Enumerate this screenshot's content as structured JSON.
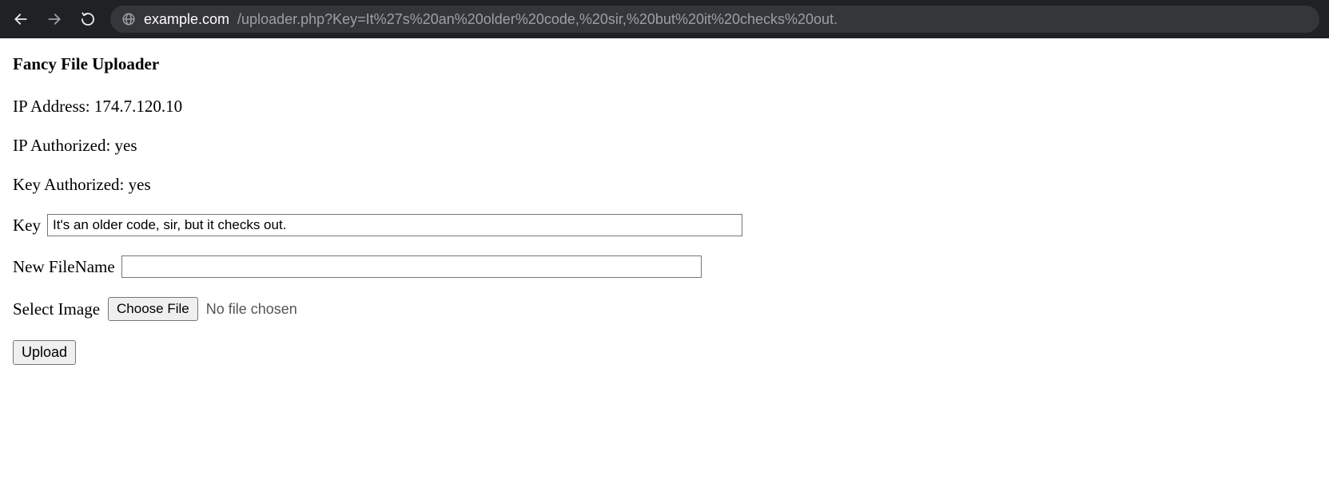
{
  "browser": {
    "url_domain": "example.com",
    "url_path": "/uploader.php?Key=It%27s%20an%20older%20code,%20sir,%20but%20it%20checks%20out."
  },
  "page": {
    "heading": "Fancy File Uploader",
    "ip_address_label": "IP Address: ",
    "ip_address_value": "174.7.120.10",
    "ip_authorized_label": "IP Authorized: ",
    "ip_authorized_value": "yes",
    "key_authorized_label": "Key Authorized: ",
    "key_authorized_value": "yes",
    "form": {
      "key_label": "Key",
      "key_value": "It's an older code, sir, but it checks out.",
      "filename_label": "New FileName",
      "filename_value": "",
      "select_image_label": "Select Image",
      "choose_file_button": "Choose File",
      "file_status": "No file chosen",
      "submit_label": "Upload"
    }
  }
}
